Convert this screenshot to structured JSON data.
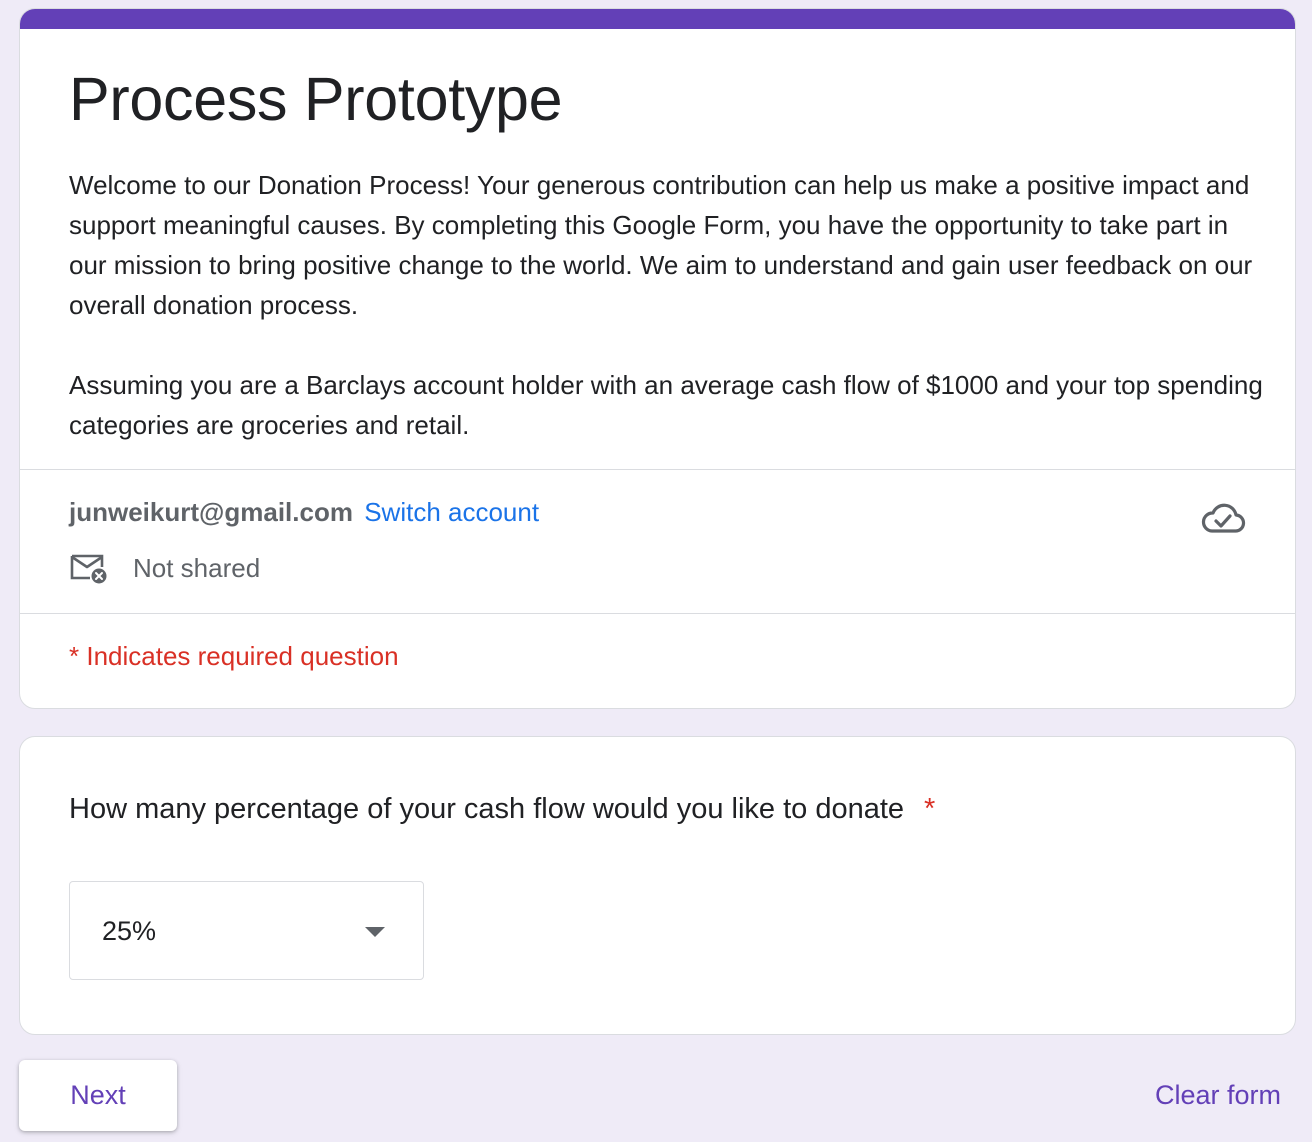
{
  "form": {
    "title": "Process Prototype",
    "description_paragraphs": [
      "Welcome to our Donation Process! Your generous contribution can help us make a positive impact and support meaningful causes. By completing this Google Form, you have the opportunity to take part in our mission to bring positive change to the world. We aim to understand and gain user feedback on our overall donation process.",
      "Assuming you are a Barclays account holder with an average cash flow of $1000 and your top spending categories are groceries and retail."
    ],
    "accent_color": "#6340b7"
  },
  "account": {
    "email": "junweikurt@gmail.com",
    "switch_label": "Switch account",
    "shared_status": "Not shared",
    "status_icon": "cloud-check-icon",
    "mail_icon": "mail-not-shared-icon"
  },
  "required_note": "* Indicates required question",
  "question": {
    "label": "How many percentage of your cash flow would you like to donate",
    "required_marker": "*",
    "selected_value": "25%"
  },
  "footer": {
    "next_label": "Next",
    "clear_label": "Clear form"
  },
  "colors": {
    "background": "#efebf7",
    "link": "#1a73e8",
    "required": "#d93025",
    "secondary_text": "#5f6368"
  }
}
